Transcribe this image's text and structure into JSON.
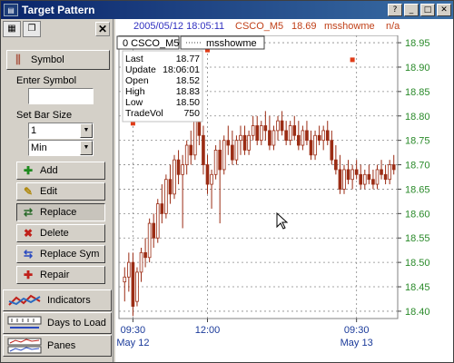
{
  "window": {
    "title": "Target Pattern"
  },
  "sidebar": {
    "symbol_label": "Symbol",
    "enter_symbol_label": "Enter Symbol",
    "enter_symbol_value": "",
    "bar_size_label": "Set Bar Size",
    "bar_size_value": "1",
    "bar_unit_value": "Min",
    "buttons": {
      "add": "Add",
      "edit": "Edit",
      "replace": "Replace",
      "delete": "Delete",
      "replace_sym": "Replace Sym",
      "repair": "Repair"
    },
    "nav": {
      "indicators": "Indicators",
      "days_to_load": "Days to Load",
      "panes": "Panes"
    }
  },
  "chart_header": {
    "datetime": "2005/05/12 18:05:11",
    "symbol": "CSCO_M5",
    "price": "18.69",
    "study": "msshowme",
    "study_value": "n/a"
  },
  "legend": {
    "symbol": "CSCO_M5",
    "study": "msshowme"
  },
  "quote": {
    "rows": [
      {
        "label": "Last",
        "value": "18.77"
      },
      {
        "label": "Update",
        "value": "18:06:01"
      },
      {
        "label": "Open",
        "value": "18.52"
      },
      {
        "label": "High",
        "value": "18.83"
      },
      {
        "label": "Low",
        "value": "18.50"
      },
      {
        "label": "TradeVol",
        "value": "750"
      }
    ]
  },
  "colors": {
    "candle": "#9b2c14",
    "marker": "#e03c18",
    "axis_text": "#2a8a2a",
    "time_text": "#1a3a9a",
    "grid": "#888888"
  },
  "chart_data": {
    "type": "candlestick",
    "symbol": "CSCO_M5",
    "x_ticks": [
      {
        "label": "09:30",
        "sub": "May 12"
      },
      {
        "label": "12:00",
        "sub": ""
      },
      {
        "label": "09:30",
        "sub": "May 13"
      }
    ],
    "y_ticks": [
      "18.95",
      "18.90",
      "18.85",
      "18.80",
      "18.75",
      "18.70",
      "18.65",
      "18.60",
      "18.55",
      "18.50",
      "18.45",
      "18.40"
    ],
    "ylim": [
      18.385,
      18.965
    ],
    "last_close": 18.69,
    "marker_points": [
      {
        "bar": 2,
        "price": 18.785
      },
      {
        "bar": 7,
        "price": 18.815
      },
      {
        "bar": 20,
        "price": 18.935
      },
      {
        "bar": 55,
        "price": 18.915
      }
    ],
    "candles": [
      {
        "o": 18.46,
        "h": 18.49,
        "l": 18.42,
        "c": 18.47
      },
      {
        "o": 18.47,
        "h": 18.52,
        "l": 18.44,
        "c": 18.5
      },
      {
        "o": 18.5,
        "h": 18.52,
        "l": 18.39,
        "c": 18.41
      },
      {
        "o": 18.42,
        "h": 18.49,
        "l": 18.41,
        "c": 18.48
      },
      {
        "o": 18.48,
        "h": 18.53,
        "l": 18.46,
        "c": 18.52
      },
      {
        "o": 18.52,
        "h": 18.55,
        "l": 18.49,
        "c": 18.51
      },
      {
        "o": 18.51,
        "h": 18.59,
        "l": 18.5,
        "c": 18.58
      },
      {
        "o": 18.58,
        "h": 18.6,
        "l": 18.53,
        "c": 18.55
      },
      {
        "o": 18.55,
        "h": 18.63,
        "l": 18.54,
        "c": 18.62
      },
      {
        "o": 18.62,
        "h": 18.66,
        "l": 18.58,
        "c": 18.6
      },
      {
        "o": 18.6,
        "h": 18.68,
        "l": 18.59,
        "c": 18.67
      },
      {
        "o": 18.67,
        "h": 18.7,
        "l": 18.62,
        "c": 18.64
      },
      {
        "o": 18.64,
        "h": 18.72,
        "l": 18.63,
        "c": 18.71
      },
      {
        "o": 18.71,
        "h": 18.73,
        "l": 18.66,
        "c": 18.68
      },
      {
        "o": 18.68,
        "h": 18.72,
        "l": 18.57,
        "c": 18.7
      },
      {
        "o": 18.7,
        "h": 18.75,
        "l": 18.68,
        "c": 18.74
      },
      {
        "o": 18.74,
        "h": 18.77,
        "l": 18.7,
        "c": 18.72
      },
      {
        "o": 18.72,
        "h": 18.8,
        "l": 18.71,
        "c": 18.79
      },
      {
        "o": 18.79,
        "h": 18.82,
        "l": 18.74,
        "c": 18.76
      },
      {
        "o": 18.76,
        "h": 18.78,
        "l": 18.68,
        "c": 18.7
      },
      {
        "o": 18.7,
        "h": 18.72,
        "l": 18.64,
        "c": 18.66
      },
      {
        "o": 18.66,
        "h": 18.69,
        "l": 18.61,
        "c": 18.68
      },
      {
        "o": 18.68,
        "h": 18.74,
        "l": 18.67,
        "c": 18.73
      },
      {
        "o": 18.73,
        "h": 18.75,
        "l": 18.58,
        "c": 18.69
      },
      {
        "o": 18.69,
        "h": 18.76,
        "l": 18.68,
        "c": 18.75
      },
      {
        "o": 18.75,
        "h": 18.78,
        "l": 18.72,
        "c": 18.74
      },
      {
        "o": 18.74,
        "h": 18.77,
        "l": 18.7,
        "c": 18.71
      },
      {
        "o": 18.71,
        "h": 18.76,
        "l": 18.7,
        "c": 18.75
      },
      {
        "o": 18.75,
        "h": 18.78,
        "l": 18.72,
        "c": 18.76
      },
      {
        "o": 18.76,
        "h": 18.78,
        "l": 18.72,
        "c": 18.73
      },
      {
        "o": 18.73,
        "h": 18.77,
        "l": 18.72,
        "c": 18.76
      },
      {
        "o": 18.76,
        "h": 18.8,
        "l": 18.75,
        "c": 18.78
      },
      {
        "o": 18.78,
        "h": 18.8,
        "l": 18.74,
        "c": 18.75
      },
      {
        "o": 18.75,
        "h": 18.79,
        "l": 18.74,
        "c": 18.78
      },
      {
        "o": 18.78,
        "h": 18.81,
        "l": 18.75,
        "c": 18.77
      },
      {
        "o": 18.77,
        "h": 18.8,
        "l": 18.73,
        "c": 18.74
      },
      {
        "o": 18.74,
        "h": 18.78,
        "l": 18.73,
        "c": 18.77
      },
      {
        "o": 18.77,
        "h": 18.8,
        "l": 18.75,
        "c": 18.79
      },
      {
        "o": 18.79,
        "h": 18.81,
        "l": 18.76,
        "c": 18.77
      },
      {
        "o": 18.77,
        "h": 18.79,
        "l": 18.74,
        "c": 18.75
      },
      {
        "o": 18.75,
        "h": 18.79,
        "l": 18.74,
        "c": 18.78
      },
      {
        "o": 18.78,
        "h": 18.8,
        "l": 18.75,
        "c": 18.76
      },
      {
        "o": 18.76,
        "h": 18.79,
        "l": 18.73,
        "c": 18.74
      },
      {
        "o": 18.74,
        "h": 18.78,
        "l": 18.73,
        "c": 18.77
      },
      {
        "o": 18.77,
        "h": 18.79,
        "l": 18.74,
        "c": 18.75
      },
      {
        "o": 18.75,
        "h": 18.77,
        "l": 18.71,
        "c": 18.72
      },
      {
        "o": 18.72,
        "h": 18.77,
        "l": 18.71,
        "c": 18.76
      },
      {
        "o": 18.76,
        "h": 18.78,
        "l": 18.74,
        "c": 18.75
      },
      {
        "o": 18.75,
        "h": 18.78,
        "l": 18.73,
        "c": 18.77
      },
      {
        "o": 18.77,
        "h": 18.79,
        "l": 18.74,
        "c": 18.75
      },
      {
        "o": 18.75,
        "h": 18.77,
        "l": 18.7,
        "c": 18.71
      },
      {
        "o": 18.71,
        "h": 18.74,
        "l": 18.68,
        "c": 18.69
      },
      {
        "o": 18.69,
        "h": 18.72,
        "l": 18.64,
        "c": 18.65
      },
      {
        "o": 18.65,
        "h": 18.7,
        "l": 18.64,
        "c": 18.69
      },
      {
        "o": 18.69,
        "h": 18.71,
        "l": 18.66,
        "c": 18.67
      },
      {
        "o": 18.67,
        "h": 18.7,
        "l": 18.65,
        "c": 18.69
      },
      {
        "o": 18.69,
        "h": 18.71,
        "l": 18.67,
        "c": 18.68
      },
      {
        "o": 18.68,
        "h": 18.7,
        "l": 18.65,
        "c": 18.66
      },
      {
        "o": 18.66,
        "h": 18.69,
        "l": 18.65,
        "c": 18.68
      },
      {
        "o": 18.68,
        "h": 18.7,
        "l": 18.66,
        "c": 18.67
      },
      {
        "o": 18.67,
        "h": 18.69,
        "l": 18.65,
        "c": 18.66
      },
      {
        "o": 18.66,
        "h": 18.7,
        "l": 18.65,
        "c": 18.69
      },
      {
        "o": 18.69,
        "h": 18.71,
        "l": 18.67,
        "c": 18.68
      },
      {
        "o": 18.68,
        "h": 18.7,
        "l": 18.66,
        "c": 18.67
      },
      {
        "o": 18.67,
        "h": 18.71,
        "l": 18.66,
        "c": 18.7
      },
      {
        "o": 18.7,
        "h": 18.72,
        "l": 18.68,
        "c": 18.69
      }
    ]
  }
}
